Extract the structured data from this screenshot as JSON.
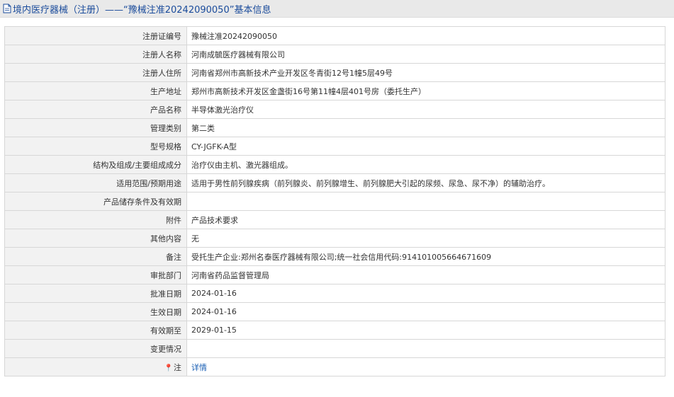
{
  "header": {
    "title": "境内医疗器械（注册）——“豫械注准20242090050”基本信息"
  },
  "rows": [
    {
      "label": "注册证编号",
      "value": "豫械注准20242090050"
    },
    {
      "label": "注册人名称",
      "value": "河南成毓医疗器械有限公司"
    },
    {
      "label": "注册人住所",
      "value": "河南省郑州市高新技术产业开发区冬青街12号1幢5层49号"
    },
    {
      "label": "生产地址",
      "value": "郑州市高新技术开发区金盏街16号第11幢4层401号房（委托生产）"
    },
    {
      "label": "产品名称",
      "value": "半导体激光治疗仪"
    },
    {
      "label": "管理类别",
      "value": "第二类"
    },
    {
      "label": "型号规格",
      "value": "CY-JGFK-A型"
    },
    {
      "label": "结构及组成/主要组成成分",
      "value": "治疗仪由主机、激光器组成。"
    },
    {
      "label": "适用范围/预期用途",
      "value": "适用于男性前列腺疾病（前列腺炎、前列腺增生、前列腺肥大引起的尿频、尿急、尿不净）的辅助治疗。"
    },
    {
      "label": "产品储存条件及有效期",
      "value": ""
    },
    {
      "label": "附件",
      "value": "产品技术要求"
    },
    {
      "label": "其他内容",
      "value": "无"
    },
    {
      "label": "备注",
      "value": "受托生产企业:郑州名泰医疗器械有限公司;统一社会信用代码:914101005664671609"
    },
    {
      "label": "审批部门",
      "value": "河南省药品监督管理局"
    },
    {
      "label": "批准日期",
      "value": "2024-01-16"
    },
    {
      "label": "生效日期",
      "value": "2024-01-16"
    },
    {
      "label": "有效期至",
      "value": "2029-01-15"
    },
    {
      "label": "变更情况",
      "value": ""
    }
  ],
  "note": {
    "label": "注",
    "link_text": "详情"
  }
}
